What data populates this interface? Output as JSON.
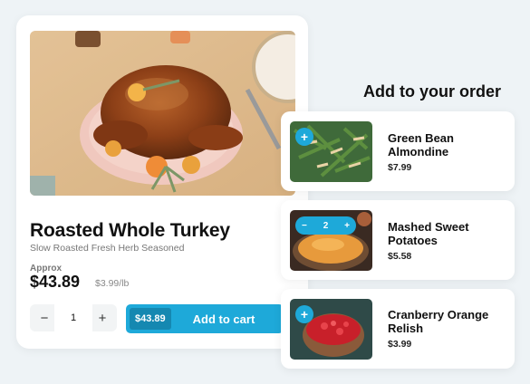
{
  "product": {
    "title": "Roasted Whole Turkey",
    "subtitle": "Slow Roasted Fresh Herb Seasoned",
    "approx_label": "Approx",
    "price": "$43.89",
    "unit_price": "$3.99/lb",
    "quantity": "1",
    "minus": "−",
    "plus": "+",
    "cart_price": "$43.89",
    "cart_label": "Add to cart"
  },
  "addons": {
    "title": "Add to your order",
    "items": [
      {
        "name": "Green Bean Almondine",
        "price": "$7.99",
        "plus": "+"
      },
      {
        "name": "Mashed Sweet Potatoes",
        "price": "$5.58",
        "quantity": "2",
        "minus": "−",
        "plus": "+"
      },
      {
        "name": "Cranberry Orange Relish",
        "price": "$3.99",
        "plus": "+"
      }
    ]
  },
  "colors": {
    "accent": "#1ea9d9",
    "accent_dark": "#1588b1",
    "background": "#eef3f6"
  }
}
